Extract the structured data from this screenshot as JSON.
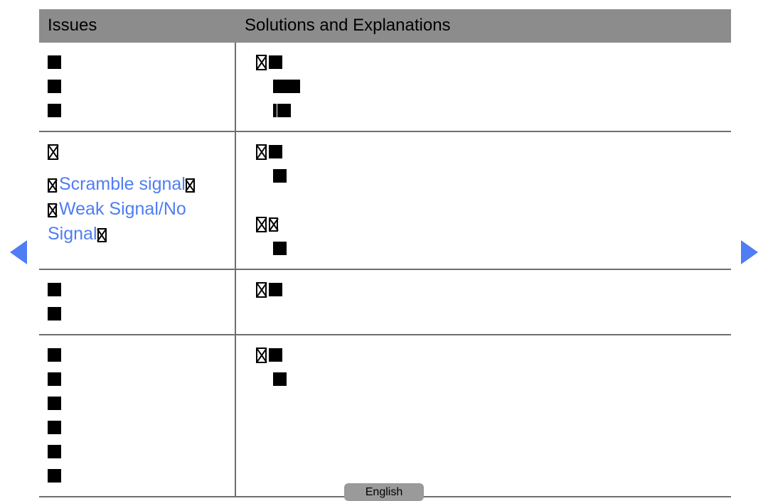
{
  "nav": {
    "prev_icon": "triangle-left-icon",
    "next_icon": "triangle-right-icon",
    "accent_color": "#4f7df3"
  },
  "table": {
    "header": {
      "issues": "Issues",
      "solutions": "Solutions and Explanations",
      "background_color": "#8c8c8c"
    },
    "border_color": "#6e6e6e",
    "rows": [
      {
        "issues_lines": [
          {
            "indent": 0,
            "glyphs": [
              "box"
            ]
          },
          {
            "indent": 0,
            "glyphs": [
              "box"
            ]
          },
          {
            "indent": 0,
            "glyphs": [
              "box"
            ]
          }
        ],
        "solutions_lines": [
          {
            "indent": 0,
            "glyphs": [
              "xbox",
              "box"
            ]
          },
          {
            "indent": 1,
            "glyphs": [
              "box-wide"
            ]
          },
          {
            "indent": 1,
            "glyphs": [
              "bar",
              "box"
            ]
          }
        ]
      },
      {
        "issues_lines": [
          {
            "indent": 0,
            "glyphs": [
              "xbox"
            ]
          }
        ],
        "issues_text": [
          "Scramble signal",
          "Weak Signal/No",
          "Signal"
        ],
        "issues_text_color": "#4f7df3",
        "solutions_lines": [
          {
            "indent": 0,
            "glyphs": [
              "xbox",
              "box"
            ]
          },
          {
            "indent": 1,
            "glyphs": [
              "box"
            ]
          },
          {
            "indent": 0,
            "glyphs": [
              "xbox",
              "xbox-small"
            ]
          },
          {
            "indent": 1,
            "glyphs": [
              "box"
            ]
          }
        ]
      },
      {
        "issues_lines": [
          {
            "indent": 0,
            "glyphs": [
              "box"
            ]
          },
          {
            "indent": 0,
            "glyphs": [
              "box"
            ]
          }
        ],
        "solutions_lines": [
          {
            "indent": 0,
            "glyphs": [
              "xbox",
              "box"
            ]
          }
        ]
      },
      {
        "issues_lines": [
          {
            "indent": 0,
            "glyphs": [
              "box"
            ]
          },
          {
            "indent": 0,
            "glyphs": [
              "box"
            ]
          },
          {
            "indent": 0,
            "glyphs": [
              "box"
            ]
          },
          {
            "indent": 0,
            "glyphs": [
              "box"
            ]
          },
          {
            "indent": 0,
            "glyphs": [
              "box"
            ]
          },
          {
            "indent": 0,
            "glyphs": [
              "box"
            ]
          }
        ],
        "solutions_lines": [
          {
            "indent": 0,
            "glyphs": [
              "xbox",
              "box"
            ]
          },
          {
            "indent": 1,
            "glyphs": [
              "box"
            ]
          }
        ]
      }
    ]
  },
  "footer": {
    "language_label": "English"
  }
}
